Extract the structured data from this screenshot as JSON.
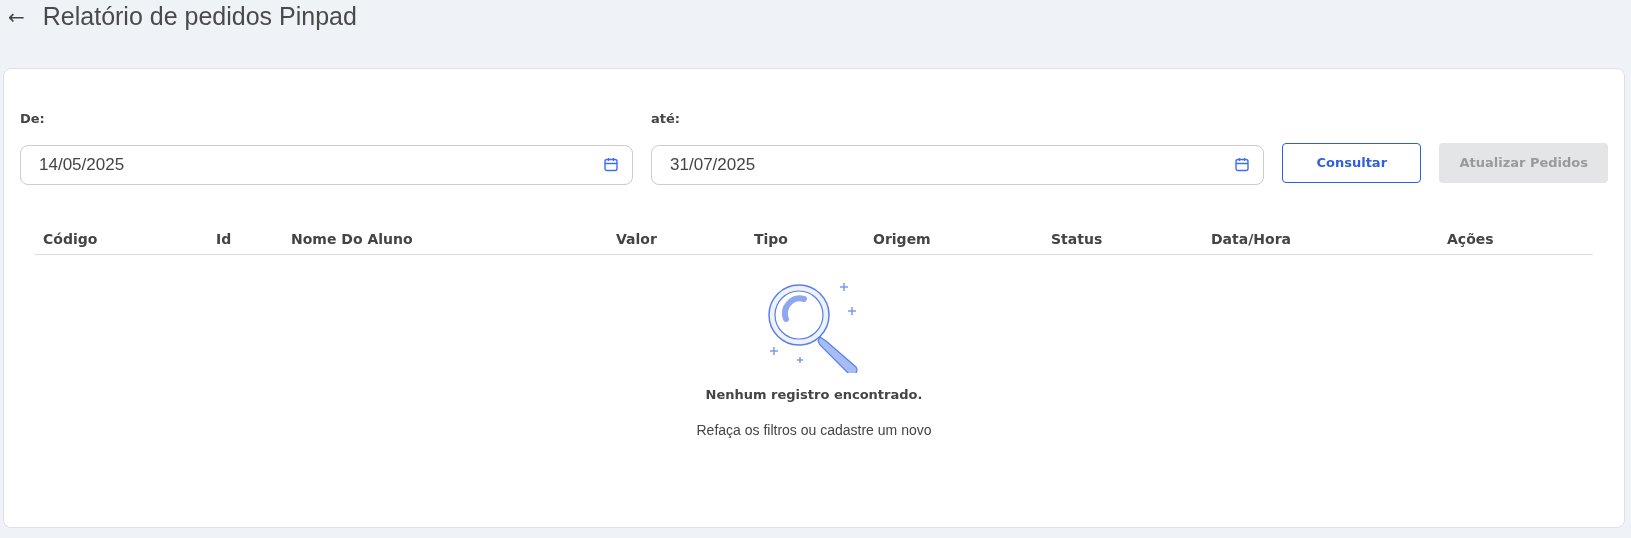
{
  "header": {
    "back_icon": "←",
    "title": "Relatório de pedidos Pinpad"
  },
  "filters": [
    {
      "label": "De:",
      "value": "14/05/2025"
    },
    {
      "label": "até:",
      "value": "31/07/2025"
    }
  ],
  "buttons": [
    {
      "label": "Consultar",
      "disabled": false
    },
    {
      "label": "Atualizar Pedidos",
      "disabled": true
    }
  ],
  "table": {
    "columns": [
      "Código",
      "Id",
      "Nome Do Aluno",
      "Valor",
      "Tipo",
      "Origem",
      "Status",
      "Data/Hora",
      "Ações"
    ]
  },
  "empty_state": {
    "title": "Nenhum registro encontrado.",
    "message": "Refaça os filtros ou cadastre um novo"
  }
}
